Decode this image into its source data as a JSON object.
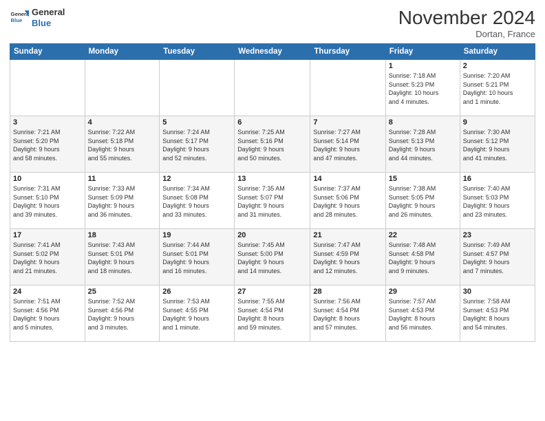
{
  "header": {
    "logo_line1": "General",
    "logo_line2": "Blue",
    "month": "November 2024",
    "location": "Dortan, France"
  },
  "weekdays": [
    "Sunday",
    "Monday",
    "Tuesday",
    "Wednesday",
    "Thursday",
    "Friday",
    "Saturday"
  ],
  "weeks": [
    [
      {
        "day": "",
        "info": ""
      },
      {
        "day": "",
        "info": ""
      },
      {
        "day": "",
        "info": ""
      },
      {
        "day": "",
        "info": ""
      },
      {
        "day": "",
        "info": ""
      },
      {
        "day": "1",
        "info": "Sunrise: 7:18 AM\nSunset: 5:23 PM\nDaylight: 10 hours\nand 4 minutes."
      },
      {
        "day": "2",
        "info": "Sunrise: 7:20 AM\nSunset: 5:21 PM\nDaylight: 10 hours\nand 1 minute."
      }
    ],
    [
      {
        "day": "3",
        "info": "Sunrise: 7:21 AM\nSunset: 5:20 PM\nDaylight: 9 hours\nand 58 minutes."
      },
      {
        "day": "4",
        "info": "Sunrise: 7:22 AM\nSunset: 5:18 PM\nDaylight: 9 hours\nand 55 minutes."
      },
      {
        "day": "5",
        "info": "Sunrise: 7:24 AM\nSunset: 5:17 PM\nDaylight: 9 hours\nand 52 minutes."
      },
      {
        "day": "6",
        "info": "Sunrise: 7:25 AM\nSunset: 5:16 PM\nDaylight: 9 hours\nand 50 minutes."
      },
      {
        "day": "7",
        "info": "Sunrise: 7:27 AM\nSunset: 5:14 PM\nDaylight: 9 hours\nand 47 minutes."
      },
      {
        "day": "8",
        "info": "Sunrise: 7:28 AM\nSunset: 5:13 PM\nDaylight: 9 hours\nand 44 minutes."
      },
      {
        "day": "9",
        "info": "Sunrise: 7:30 AM\nSunset: 5:12 PM\nDaylight: 9 hours\nand 41 minutes."
      }
    ],
    [
      {
        "day": "10",
        "info": "Sunrise: 7:31 AM\nSunset: 5:10 PM\nDaylight: 9 hours\nand 39 minutes."
      },
      {
        "day": "11",
        "info": "Sunrise: 7:33 AM\nSunset: 5:09 PM\nDaylight: 9 hours\nand 36 minutes."
      },
      {
        "day": "12",
        "info": "Sunrise: 7:34 AM\nSunset: 5:08 PM\nDaylight: 9 hours\nand 33 minutes."
      },
      {
        "day": "13",
        "info": "Sunrise: 7:35 AM\nSunset: 5:07 PM\nDaylight: 9 hours\nand 31 minutes."
      },
      {
        "day": "14",
        "info": "Sunrise: 7:37 AM\nSunset: 5:06 PM\nDaylight: 9 hours\nand 28 minutes."
      },
      {
        "day": "15",
        "info": "Sunrise: 7:38 AM\nSunset: 5:05 PM\nDaylight: 9 hours\nand 26 minutes."
      },
      {
        "day": "16",
        "info": "Sunrise: 7:40 AM\nSunset: 5:03 PM\nDaylight: 9 hours\nand 23 minutes."
      }
    ],
    [
      {
        "day": "17",
        "info": "Sunrise: 7:41 AM\nSunset: 5:02 PM\nDaylight: 9 hours\nand 21 minutes."
      },
      {
        "day": "18",
        "info": "Sunrise: 7:43 AM\nSunset: 5:01 PM\nDaylight: 9 hours\nand 18 minutes."
      },
      {
        "day": "19",
        "info": "Sunrise: 7:44 AM\nSunset: 5:01 PM\nDaylight: 9 hours\nand 16 minutes."
      },
      {
        "day": "20",
        "info": "Sunrise: 7:45 AM\nSunset: 5:00 PM\nDaylight: 9 hours\nand 14 minutes."
      },
      {
        "day": "21",
        "info": "Sunrise: 7:47 AM\nSunset: 4:59 PM\nDaylight: 9 hours\nand 12 minutes."
      },
      {
        "day": "22",
        "info": "Sunrise: 7:48 AM\nSunset: 4:58 PM\nDaylight: 9 hours\nand 9 minutes."
      },
      {
        "day": "23",
        "info": "Sunrise: 7:49 AM\nSunset: 4:57 PM\nDaylight: 9 hours\nand 7 minutes."
      }
    ],
    [
      {
        "day": "24",
        "info": "Sunrise: 7:51 AM\nSunset: 4:56 PM\nDaylight: 9 hours\nand 5 minutes."
      },
      {
        "day": "25",
        "info": "Sunrise: 7:52 AM\nSunset: 4:56 PM\nDaylight: 9 hours\nand 3 minutes."
      },
      {
        "day": "26",
        "info": "Sunrise: 7:53 AM\nSunset: 4:55 PM\nDaylight: 9 hours\nand 1 minute."
      },
      {
        "day": "27",
        "info": "Sunrise: 7:55 AM\nSunset: 4:54 PM\nDaylight: 8 hours\nand 59 minutes."
      },
      {
        "day": "28",
        "info": "Sunrise: 7:56 AM\nSunset: 4:54 PM\nDaylight: 8 hours\nand 57 minutes."
      },
      {
        "day": "29",
        "info": "Sunrise: 7:57 AM\nSunset: 4:53 PM\nDaylight: 8 hours\nand 56 minutes."
      },
      {
        "day": "30",
        "info": "Sunrise: 7:58 AM\nSunset: 4:53 PM\nDaylight: 8 hours\nand 54 minutes."
      }
    ]
  ]
}
